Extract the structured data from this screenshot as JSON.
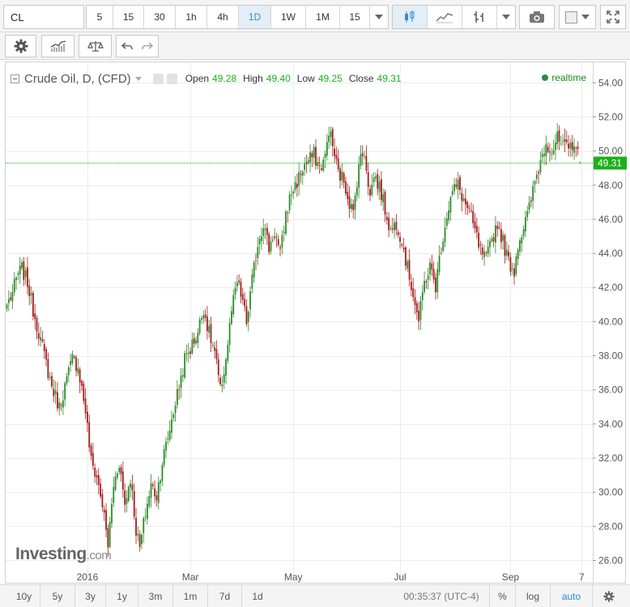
{
  "toolbar": {
    "symbol": "CL",
    "timeframes": [
      {
        "label": "5",
        "active": false
      },
      {
        "label": "15",
        "active": false
      },
      {
        "label": "30",
        "active": false
      },
      {
        "label": "1h",
        "active": false
      },
      {
        "label": "4h",
        "active": false
      },
      {
        "label": "1D",
        "active": true
      },
      {
        "label": "1W",
        "active": false
      },
      {
        "label": "1M",
        "active": false
      },
      {
        "label": "15",
        "active": false
      }
    ],
    "icons": [
      "candlestick-icon",
      "area-chart-icon",
      "bar-chart-icon",
      "camera-icon",
      "color-square-icon",
      "fullscreen-icon"
    ]
  },
  "toolbar2": {
    "icons": [
      "gear-icon",
      "indicators-icon",
      "compare-scale-icon",
      "undo-icon",
      "redo-icon"
    ]
  },
  "legend": {
    "title": "Crude Oil, D, (CFD)",
    "open_label": "Open",
    "open": "49.28",
    "high_label": "High",
    "high": "49.40",
    "low_label": "Low",
    "low": "49.25",
    "close_label": "Close",
    "close": "49.31",
    "realtime": "realtime"
  },
  "watermark": {
    "brand": "Investing",
    "suffix": ".com"
  },
  "chart_data": {
    "type": "candlestick",
    "title": "Crude Oil, D, (CFD)",
    "ylim": [
      24.6,
      55.2
    ],
    "y_ticks": [
      "54.00",
      "52.00",
      "50.00",
      "48.00",
      "46.00",
      "44.00",
      "42.00",
      "40.00",
      "38.00",
      "36.00",
      "34.00",
      "32.00",
      "30.00",
      "28.00",
      "26.00"
    ],
    "x_ticks": [
      "2016",
      "Mar",
      "May",
      "Jul",
      "Sep",
      "7"
    ],
    "x_tick_index": [
      43,
      98,
      153,
      210,
      269,
      307
    ],
    "last_price": 49.31,
    "last_price_label": "49.31",
    "up_color": "#2a8c2a",
    "down_color": "#a61c1c",
    "current_price_color": "#1bb01b",
    "anchors": [
      [
        0,
        41.0
      ],
      [
        3,
        41.7
      ],
      [
        6,
        42.8
      ],
      [
        8,
        43.1
      ],
      [
        11,
        42.3
      ],
      [
        14,
        40.7
      ],
      [
        17,
        39.4
      ],
      [
        20,
        38.0
      ],
      [
        24,
        36.2
      ],
      [
        28,
        35.0
      ],
      [
        32,
        36.6
      ],
      [
        35,
        37.8
      ],
      [
        38,
        37.4
      ],
      [
        42,
        34.8
      ],
      [
        45,
        31.8
      ],
      [
        48,
        30.9
      ],
      [
        51,
        29.3
      ],
      [
        54,
        26.9
      ],
      [
        57,
        30.4
      ],
      [
        60,
        31.8
      ],
      [
        63,
        29.3
      ],
      [
        66,
        30.9
      ],
      [
        69,
        27.8
      ],
      [
        71,
        26.7
      ],
      [
        74,
        28.8
      ],
      [
        77,
        30.4
      ],
      [
        80,
        29.8
      ],
      [
        83,
        31.8
      ],
      [
        86,
        33.2
      ],
      [
        89,
        34.8
      ],
      [
        92,
        36.2
      ],
      [
        95,
        37.8
      ],
      [
        98,
        38.4
      ],
      [
        102,
        39.4
      ],
      [
        105,
        40.8
      ],
      [
        108,
        39.3
      ],
      [
        111,
        38.2
      ],
      [
        114,
        35.9
      ],
      [
        117,
        37.8
      ],
      [
        120,
        40.6
      ],
      [
        123,
        42.3
      ],
      [
        126,
        41.2
      ],
      [
        128,
        39.9
      ],
      [
        131,
        42.4
      ],
      [
        134,
        44.6
      ],
      [
        137,
        45.8
      ],
      [
        140,
        44.3
      ],
      [
        143,
        45.3
      ],
      [
        146,
        43.9
      ],
      [
        149,
        46.3
      ],
      [
        152,
        47.6
      ],
      [
        155,
        48.2
      ],
      [
        158,
        49.0
      ],
      [
        161,
        49.4
      ],
      [
        164,
        49.8
      ],
      [
        167,
        49.0
      ],
      [
        170,
        49.6
      ],
      [
        172,
        51.3
      ],
      [
        174,
        50.3
      ],
      [
        177,
        48.7
      ],
      [
        180,
        48.3
      ],
      [
        183,
        47.0
      ],
      [
        185,
        46.3
      ],
      [
        188,
        49.3
      ],
      [
        191,
        50.0
      ],
      [
        194,
        47.3
      ],
      [
        196,
        48.6
      ],
      [
        199,
        47.9
      ],
      [
        202,
        46.6
      ],
      [
        205,
        45.3
      ],
      [
        208,
        45.8
      ],
      [
        211,
        44.8
      ],
      [
        214,
        43.1
      ],
      [
        217,
        41.7
      ],
      [
        220,
        40.0
      ],
      [
        223,
        42.3
      ],
      [
        226,
        43.2
      ],
      [
        229,
        42.1
      ],
      [
        232,
        44.4
      ],
      [
        235,
        46.3
      ],
      [
        238,
        47.6
      ],
      [
        241,
        48.0
      ],
      [
        244,
        47.1
      ],
      [
        247,
        46.4
      ],
      [
        250,
        45.3
      ],
      [
        253,
        44.1
      ],
      [
        256,
        43.6
      ],
      [
        259,
        44.8
      ],
      [
        262,
        45.8
      ],
      [
        265,
        44.7
      ],
      [
        268,
        43.5
      ],
      [
        271,
        43.0
      ],
      [
        273,
        44.6
      ],
      [
        276,
        45.5
      ],
      [
        279,
        46.6
      ],
      [
        282,
        48.2
      ],
      [
        285,
        49.4
      ],
      [
        288,
        50.6
      ],
      [
        291,
        50.0
      ],
      [
        294,
        50.7
      ],
      [
        297,
        50.2
      ],
      [
        300,
        50.1
      ],
      [
        303,
        50.6
      ],
      [
        306,
        49.31
      ]
    ]
  },
  "bottom_bar": {
    "ranges": [
      "10y",
      "5y",
      "3y",
      "1y",
      "3m",
      "1m",
      "7d",
      "1d"
    ],
    "clock": "00:35:37 (UTC-4)",
    "percent_label": "%",
    "log_label": "log",
    "auto_label": "auto"
  }
}
